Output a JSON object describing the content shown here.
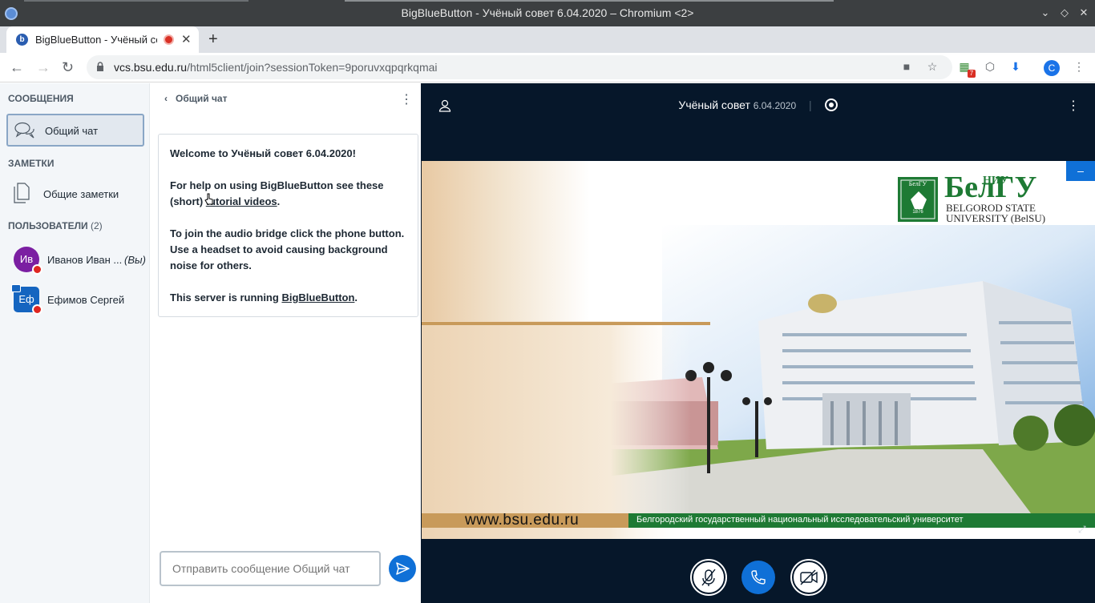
{
  "window": {
    "title": "BigBlueButton - Учёный совет 6.04.2020 – Chromium <2>"
  },
  "browser": {
    "tab_title": "BigBlueButton - Учёный совет 6.04.2020",
    "url_host": "vcs.bsu.edu.ru",
    "url_rest": "/html5client/join?sessionToken=9poruvxqpqrkqmai",
    "profile_letter": "C",
    "extension_badge": "7"
  },
  "userlist": {
    "messages_header": "СООБЩЕНИЯ",
    "public_chat_label": "Общий чат",
    "notes_header": "ЗАМЕТКИ",
    "shared_notes_label": "Общие заметки",
    "users_header": "ПОЛЬЗОВАТЕЛИ",
    "users_count": "(2)",
    "users": [
      {
        "initials": "Ив",
        "name": "Иванов Иван ...",
        "you": "(Вы)",
        "color": "#7b1fa2"
      },
      {
        "initials": "Еф",
        "name": "Ефимов Сергей",
        "color": "#1565c0"
      }
    ]
  },
  "chat": {
    "back_label": "Общий чат",
    "welcome_prefix": "Welcome to ",
    "welcome_name": "Учёный совет 6.04.2020",
    "welcome_suffix": "!",
    "help_prefix": "For help on using BigBlueButton see these (short) ",
    "help_link": "tutorial videos",
    "help_suffix": ".",
    "audio_text": "To join the audio bridge click the phone button. Use a headset to avoid causing background noise for others.",
    "server_prefix": "This server is running ",
    "server_link": "BigBlueButton",
    "server_suffix": ".",
    "input_placeholder": "Отправить сообщение Общий чат"
  },
  "meeting": {
    "name": "Учёный совет",
    "date": "6.04.2020",
    "sep": "|"
  },
  "slide": {
    "logo_short": "НИУ",
    "logo_main": "БелГУ",
    "badge_text": "БелГУ",
    "badge_year": "1876",
    "univ_line1": "BELGOROD STATE",
    "univ_line2": "UNIVERSITY (BelSU)",
    "footer_url": "www.bsu.edu.ru",
    "footer_text": "Белгородский государственный национальный исследовательский университет"
  },
  "colors": {
    "accent": "#0f70d7",
    "header_bg": "#06172a",
    "sidebar_bg": "#f3f6f9",
    "logo_green": "#1e7a34"
  }
}
